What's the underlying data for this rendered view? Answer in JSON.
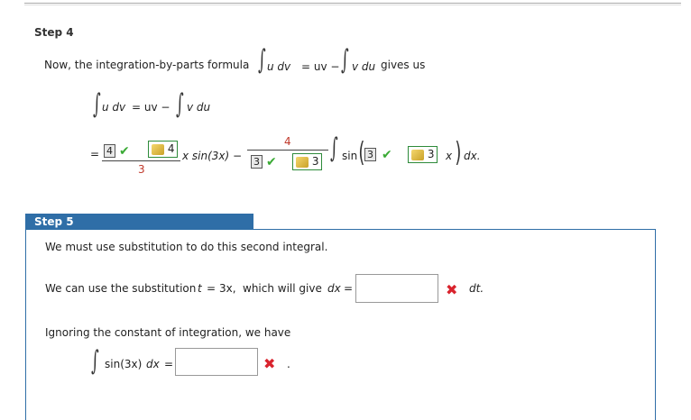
{
  "step4": {
    "title": "Step 4",
    "intro": "Now, the integration-by-parts formula",
    "formula_lhs": "u dv",
    "formula_eq": "= uv −",
    "formula_rhs": "v du",
    "gives_us": "gives us",
    "line2_lhs": "u dv",
    "line2_mid": "= uv −",
    "line2_rhs": "v du",
    "eq_sign": "=",
    "frac1_num_box": "4",
    "frac1_key_value": "4",
    "frac1_den": "3",
    "term1_tail": "x sin(3x) −",
    "frac2_num": "4",
    "frac2_den_box": "3",
    "frac2_key_value": "3",
    "sin_label": "sin",
    "sin_box": "3",
    "sin_key_value": "3",
    "x_var": "x",
    "dx_tail": "dx."
  },
  "step5": {
    "title": "Step 5",
    "line1": "We must use substitution to do this second integral.",
    "line2_pre": "We can use the substitution",
    "sub_var": "t",
    "sub_eq": "=",
    "sub_val": "3x,",
    "line2_mid": "which will give",
    "dx_label": "dx",
    "dx_eq": "=",
    "dx_input_value": "",
    "dt_label": "dt.",
    "line3": "Ignoring the constant of integration, we have",
    "integrand": "sin(3x)",
    "dx2": "dx",
    "eq2": "=",
    "int_input_value": "",
    "period": "."
  },
  "colors": {
    "correct": "#3aaa35",
    "incorrect": "#d9232d",
    "accent": "#2f6ea7"
  }
}
